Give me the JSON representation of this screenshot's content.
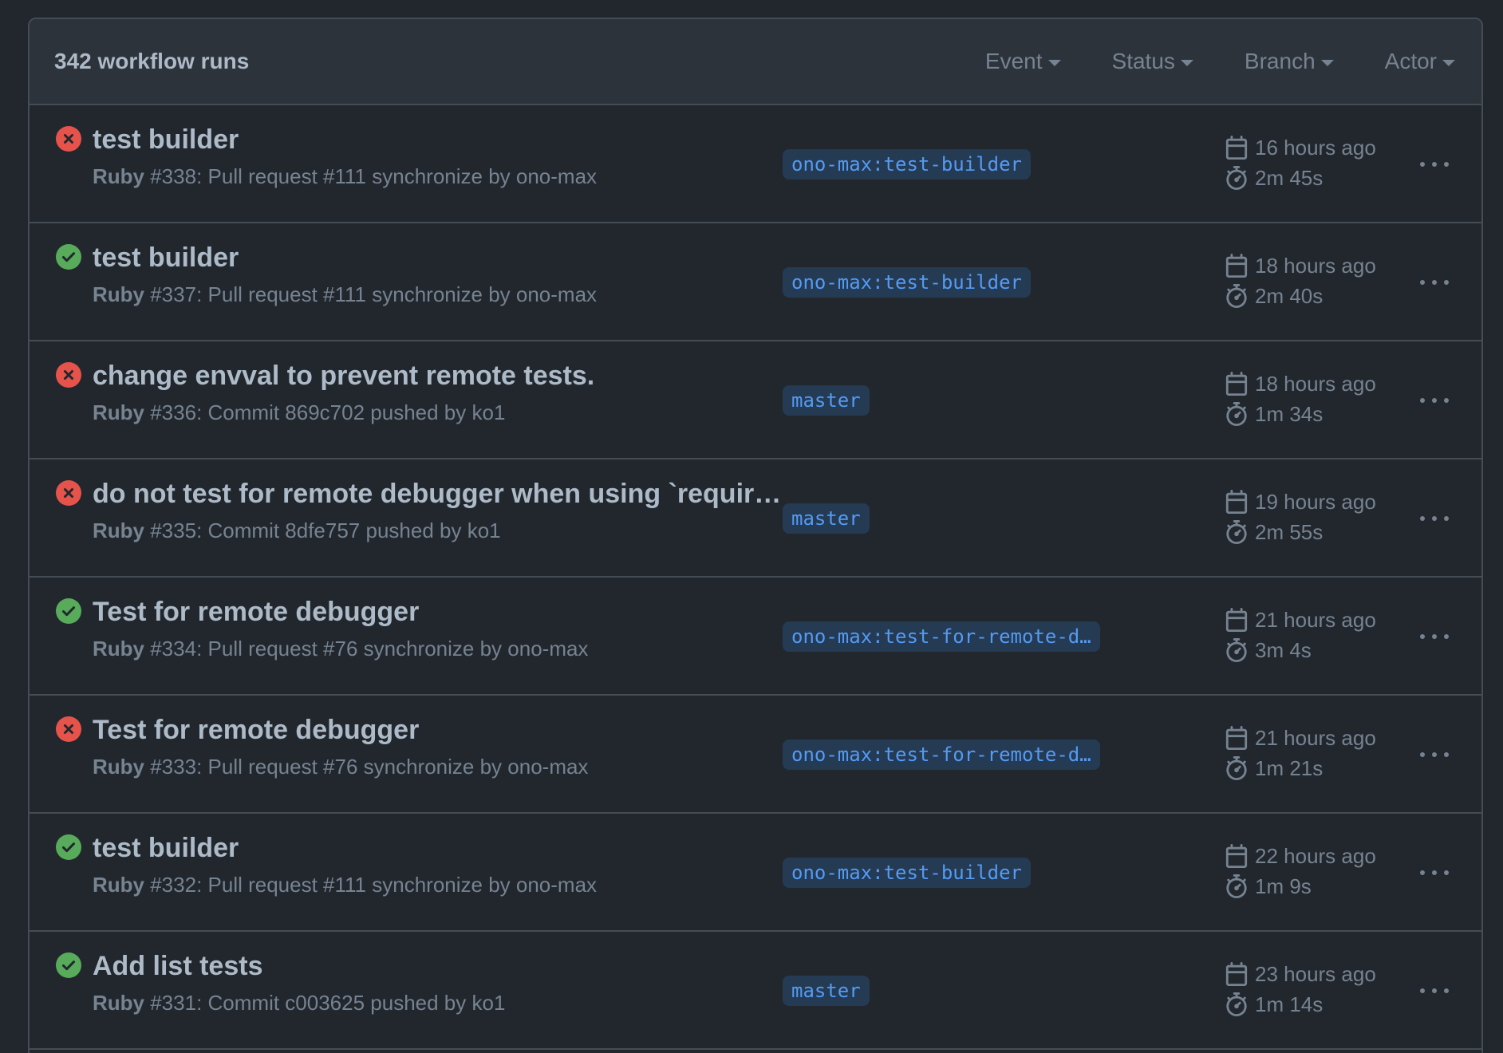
{
  "header": {
    "run_count": "342 workflow runs",
    "filters": [
      {
        "label": "Event"
      },
      {
        "label": "Status"
      },
      {
        "label": "Branch"
      },
      {
        "label": "Actor"
      }
    ]
  },
  "colors": {
    "success": "#57ab5a",
    "failure": "#e5534b",
    "branch_text": "#539bf5",
    "branch_bg": "#253a53"
  },
  "runs": [
    {
      "status": "failure",
      "title": "test builder",
      "workflow": "Ruby",
      "detail": " #338: Pull request #111 synchronize by ono-max",
      "branch": "ono-max:test-builder",
      "time": "16 hours ago",
      "duration": "2m 45s"
    },
    {
      "status": "success",
      "title": "test builder",
      "workflow": "Ruby",
      "detail": " #337: Pull request #111 synchronize by ono-max",
      "branch": "ono-max:test-builder",
      "time": "18 hours ago",
      "duration": "2m 40s"
    },
    {
      "status": "failure",
      "title": "change envval to prevent remote tests.",
      "workflow": "Ruby",
      "detail": " #336: Commit 869c702 pushed by ko1",
      "branch": "master",
      "time": "18 hours ago",
      "duration": "1m 34s"
    },
    {
      "status": "failure",
      "title": "do not test for remote debugger when using `require ...",
      "workflow": "Ruby",
      "detail": " #335: Commit 8dfe757 pushed by ko1",
      "branch": "master",
      "time": "19 hours ago",
      "duration": "2m 55s"
    },
    {
      "status": "success",
      "title": "Test for remote debugger",
      "workflow": "Ruby",
      "detail": " #334: Pull request #76 synchronize by ono-max",
      "branch": "ono-max:test-for-remote-d…",
      "time": "21 hours ago",
      "duration": "3m 4s"
    },
    {
      "status": "failure",
      "title": "Test for remote debugger",
      "workflow": "Ruby",
      "detail": " #333: Pull request #76 synchronize by ono-max",
      "branch": "ono-max:test-for-remote-d…",
      "time": "21 hours ago",
      "duration": "1m 21s"
    },
    {
      "status": "success",
      "title": "test builder",
      "workflow": "Ruby",
      "detail": " #332: Pull request #111 synchronize by ono-max",
      "branch": "ono-max:test-builder",
      "time": "22 hours ago",
      "duration": "1m 9s"
    },
    {
      "status": "success",
      "title": "Add list tests",
      "workflow": "Ruby",
      "detail": " #331: Commit c003625 pushed by ko1",
      "branch": "master",
      "time": "23 hours ago",
      "duration": "1m 14s"
    }
  ]
}
